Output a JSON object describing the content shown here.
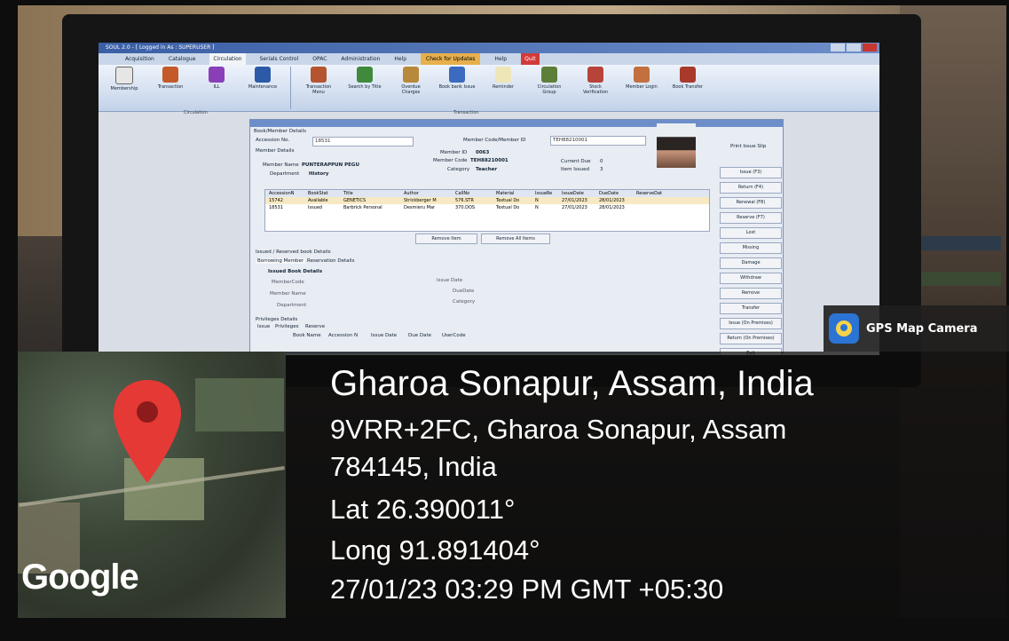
{
  "app": {
    "title": "SOUL 2.0 - [ Logged in As : SUPERUSER ]",
    "menu": [
      "Acquisition",
      "Catalogue",
      "Circulation",
      "Serials Control",
      "OPAC",
      "Administration",
      "Help"
    ],
    "check_updates": "Check for Updates",
    "help": "Help",
    "quit": "Quit",
    "ribbon": [
      "Membership",
      "Transaction",
      "ILL",
      "Maintenance",
      "Transaction Menu",
      "Search by Title",
      "Overdue Charges",
      "Book bank Issue",
      "Reminder",
      "Circulation Group",
      "Stock Verification",
      "Member Login",
      "Book Transfer"
    ],
    "ribbon_group_1": "Circulation",
    "ribbon_group_2": "Transaction"
  },
  "dialog": {
    "section": "Book/Member Details",
    "accession_label": "Accession No.",
    "accession_value": "18531",
    "member_code_label": "Member Code/Member ID",
    "member_code_value": "TEH88210001",
    "member_details": "Member Details",
    "member_id_label": "Member ID",
    "member_id_value": "0063",
    "member_code2_label": "Member Code",
    "member_code2_value": "TEH88210001",
    "current_due_label": "Current Due",
    "current_due_value": "0",
    "member_name_label": "Member Name",
    "member_name_value": "PUNTERAPPUN PEGU",
    "category_label": "Category",
    "category_value": "Teacher",
    "item_issued_label": "Item Issued",
    "item_issued_value": "3",
    "department_label": "Department",
    "department_value": "History",
    "grid_headers": [
      "AccessionN",
      "BookStat",
      "Title",
      "Author",
      "CallNo",
      "Material",
      "IssueRe",
      "IssueDate",
      "DueDate",
      "ReserveDat"
    ],
    "grid_rows": [
      [
        "15742",
        "Available",
        "GENETICS",
        "Strickberger M",
        "576.STR",
        "Textual Do",
        "N",
        "27/01/2023",
        "28/01/2023",
        ""
      ],
      [
        "18531",
        "Issued",
        "Barbrick Personal",
        "Desmieru Mar",
        "370.DOS",
        "Textual Do",
        "N",
        "27/01/2023",
        "28/01/2023",
        ""
      ]
    ],
    "remove_item": "Remove Item",
    "remove_all": "Remove All Items",
    "issued_section": "Issued / Reserved book Details",
    "tab_1": "Borrowing Member",
    "tab_2": "Reservation Details",
    "issued_book_details": "Issued Book Details",
    "ib_member_code": "MemberCode",
    "ib_member_name": "Member Name",
    "ib_department": "Department",
    "ib_issue_date": "Issue Date",
    "ib_due_date": "DueDate",
    "ib_category": "Category",
    "privileges": "Privileges Details",
    "priv_tabs": [
      "Issue",
      "Privileges",
      "Reserve"
    ],
    "priv_headers": [
      "Book Name",
      "Accession N",
      "Issue Date",
      "Due Date",
      "UserCode"
    ],
    "print_slip": "Print Issue Slip",
    "side_buttons": [
      "Issue (F3)",
      "Return (F4)",
      "Renewal (F8)",
      "Reserve (F7)",
      "Lost",
      "Missing",
      "Damage",
      "Withdraw",
      "Remove",
      "Transfer",
      "Issue (On Premises)",
      "Return (On Premises)",
      "Exit"
    ]
  },
  "gps": {
    "badge_text": "GPS Map Camera",
    "map_brand": "Google",
    "place": "Gharoa Sonapur, Assam, India",
    "address_line": "9VRR+2FC, Gharoa Sonapur, Assam",
    "postal_line": "784145, India",
    "lat": "Lat 26.390011°",
    "long": "Long 91.891404°",
    "datetime": "27/01/23 03:29 PM GMT +05:30"
  }
}
